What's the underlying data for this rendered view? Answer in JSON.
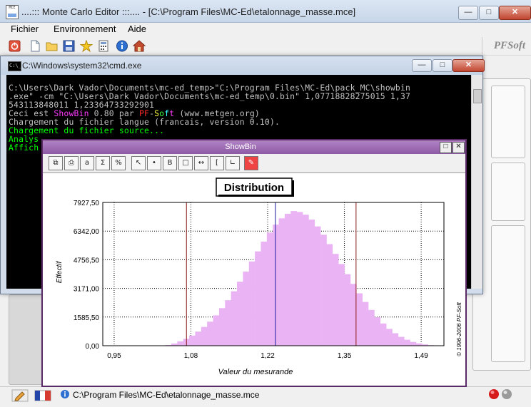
{
  "main_window": {
    "title": "....::: Monte Carlo Editor :::.... - [C:\\Program Files\\MC-Ed\\etalonnage_masse.mce]",
    "icon_text": "MCE",
    "brand": "PFSoft",
    "menu": [
      "Fichier",
      "Environnement",
      "Aide"
    ],
    "toolbar_icons": [
      "power-icon",
      "new-file-icon",
      "open-folder-icon",
      "save-icon",
      "star-icon",
      "calculator-icon",
      "info-icon",
      "home-icon"
    ],
    "status_path": "C:\\Program Files\\MC-Ed\\etalonnage_masse.mce"
  },
  "cmd_window": {
    "title": "C:\\Windows\\system32\\cmd.exe",
    "icon_text": "C:\\_",
    "lines": [
      "C:\\Users\\Dark Vador\\Documents\\mc-ed_temp>\"C:\\Program Files\\MC-Ed\\pack_MC\\showbin",
      ".exe\" -cm \"C:\\Users\\Dark Vador\\Documents\\mc-ed_temp\\0.bin\" 1,07718828275015 1,37",
      "543113848011 1,23364733292901"
    ],
    "showbin_prefix": "Ceci est ",
    "showbin_name": "ShowBin",
    "showbin_mid": " 0.80 par ",
    "pf": "PF",
    "dash": "-",
    "soft_letters": [
      "S",
      "o",
      "f",
      "t"
    ],
    "showbin_suffix": " (www.metgen.org)",
    "lang_line": "Chargement du fichier langue (francais, version 0.10).",
    "source_line": "Chargement du fichier source...",
    "analys_line": "Analys",
    "affich_line": "Affich"
  },
  "showbin": {
    "title": "ShowBin",
    "tool_icons": [
      "copy-icon",
      "print-icon",
      "text-icon",
      "sigma-icon",
      "percent-icon",
      "arrow-icon",
      "marker-icon",
      "marker-b-icon",
      "square-icon",
      "span-icon",
      "bracket-icon",
      "range-b-icon",
      "eraser-icon"
    ],
    "copyright": "© 1996-2006 PF-Soft"
  },
  "chart_data": {
    "type": "bar",
    "title": "Distribution",
    "xlabel": "Valeur du mesurande",
    "ylabel": "Effectif",
    "xlim": [
      0.93,
      1.53
    ],
    "ylim": [
      0,
      7927.5
    ],
    "xticks": [
      "0,95",
      "1,08",
      "1,22",
      "1,35",
      "1,49"
    ],
    "xtick_values": [
      0.95,
      1.085,
      1.22,
      1.355,
      1.49
    ],
    "yticks": [
      "0,00",
      "1585,50",
      "3171,00",
      "4756,50",
      "6342,00",
      "7927,50"
    ],
    "ytick_values": [
      0,
      1585.5,
      3171,
      4756.5,
      6342,
      7927.5
    ],
    "bin_start": 1.04,
    "bin_width": 0.0105,
    "values": [
      40,
      120,
      240,
      380,
      560,
      780,
      1040,
      1330,
      1680,
      2080,
      2520,
      3010,
      3540,
      4100,
      4660,
      5220,
      5760,
      6260,
      6700,
      7050,
      7300,
      7450,
      7400,
      7250,
      6980,
      6600,
      6140,
      5620,
      5080,
      4520,
      3960,
      3420,
      2900,
      2420,
      1980,
      1580,
      1230,
      930,
      690,
      490,
      330,
      210,
      130,
      70,
      30
    ],
    "bar_color": "#eab4f4",
    "lower_limit": 1.07718828275015,
    "upper_limit": 1.37543113848011,
    "mean": 1.23364733292901,
    "limit_color": "#8b1a1a",
    "mean_color": "#1a1aa0"
  }
}
